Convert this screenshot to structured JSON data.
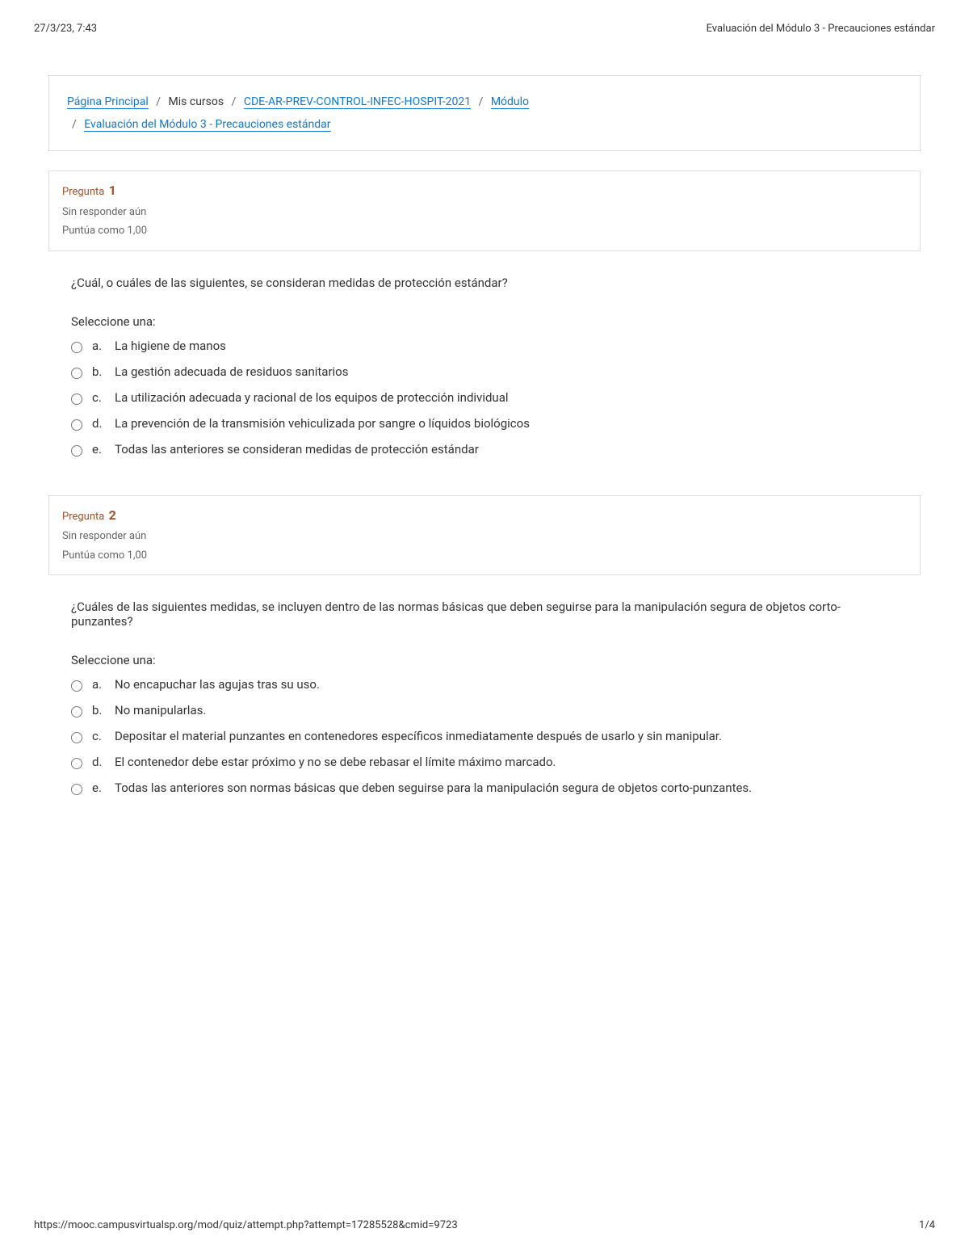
{
  "header": {
    "datetime": "27/3/23, 7:43",
    "title": "Evaluación del Módulo 3 - Precauciones estándar"
  },
  "breadcrumb": {
    "home": "Página Principal",
    "mycourses": "Mis cursos",
    "course": "CDE-AR-PREV-CONTROL-INFEC-HOSPIT-2021",
    "module": "Módulo",
    "current": " Evaluación del Módulo 3 - Precauciones estándar"
  },
  "questions": [
    {
      "label": "Pregunta",
      "number": "1",
      "status": "Sin responder aún",
      "points": "Puntúa como 1,00",
      "text": "¿Cuál, o cuáles de las siguientes, se consideran medidas de protección estándar?",
      "select_label": "Seleccione una:",
      "options": [
        {
          "letter": "a.",
          "text": "La higiene de manos"
        },
        {
          "letter": "b.",
          "text": "La gestión adecuada de residuos sanitarios"
        },
        {
          "letter": "c.",
          "text": "La utilización adecuada y racional de los equipos de protección individual"
        },
        {
          "letter": "d.",
          "text": "La prevención de la transmisión vehiculizada por sangre o líquidos biológicos"
        },
        {
          "letter": "e.",
          "text": "Todas las anteriores se consideran medidas de protección estándar"
        }
      ]
    },
    {
      "label": "Pregunta",
      "number": "2",
      "status": "Sin responder aún",
      "points": "Puntúa como 1,00",
      "text": "¿Cuáles de las siguientes medidas, se incluyen dentro de las normas básicas que deben seguirse para la manipulación segura de objetos corto-punzantes?",
      "select_label": "Seleccione una:",
      "options": [
        {
          "letter": "a.",
          "text": "No encapuchar las agujas tras su uso."
        },
        {
          "letter": "b.",
          "text": "No manipularlas."
        },
        {
          "letter": "c.",
          "text": "Depositar el material punzantes en contenedores específicos inmediatamente después de usarlo y sin manipular."
        },
        {
          "letter": "d.",
          "text": "El contenedor debe estar próximo y no se debe rebasar el límite máximo marcado."
        },
        {
          "letter": "e.",
          "text": "Todas las anteriores son normas básicas que deben seguirse para la manipulación segura de objetos corto-punzantes."
        }
      ]
    }
  ],
  "footer": {
    "url": "https://mooc.campusvirtualsp.org/mod/quiz/attempt.php?attempt=17285528&cmid=9723",
    "page": "1/4"
  }
}
